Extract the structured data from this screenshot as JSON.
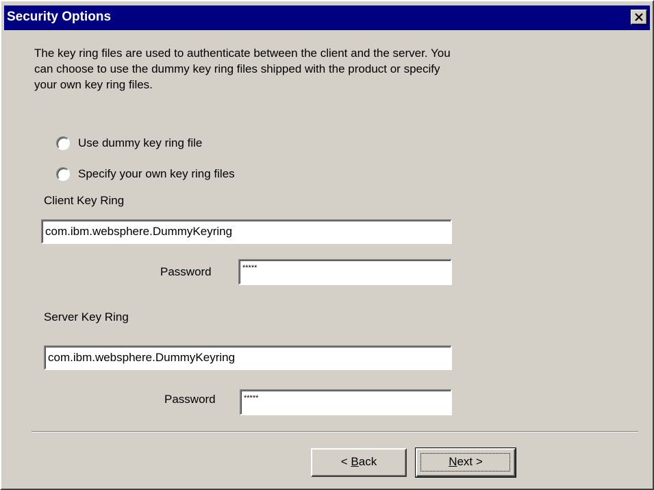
{
  "window": {
    "title": "Security Options"
  },
  "description": {
    "line1": "The key ring files are used to authenticate between the client and the server. You",
    "line2": "can choose to use the dummy key ring files shipped with the product or specify",
    "line3": "your own key ring files."
  },
  "options": {
    "dummy_label": "Use dummy key ring file",
    "own_label": "Specify your own key ring files"
  },
  "client": {
    "label": "Client Key Ring",
    "keyring_value": "com.ibm.websphere.DummyKeyring",
    "password_label": "Password",
    "password_value": "*****"
  },
  "server": {
    "label": "Server Key Ring",
    "keyring_value": "com.ibm.websphere.DummyKeyring",
    "password_label": "Password",
    "password_value": "*****"
  },
  "buttons": {
    "back_prefix": "< ",
    "back_mnemonic": "B",
    "back_rest": "ack",
    "next_mnemonic": "N",
    "next_rest": "ext >"
  },
  "icons": {
    "close": "close-icon"
  }
}
